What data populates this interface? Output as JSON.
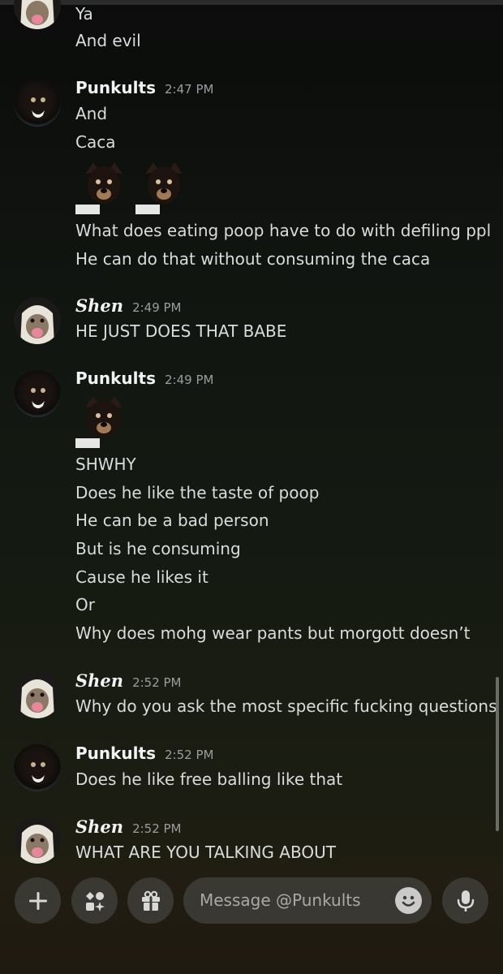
{
  "messages": [
    {
      "type": "continuation",
      "lines": [
        "Ya",
        "And evil"
      ]
    },
    {
      "type": "group",
      "user": "Punkults",
      "avatar": "dog-avatar",
      "time": "2:47 PM",
      "lines": [
        "And",
        "Caca"
      ],
      "stickers": 2,
      "after_lines": [
        "What does eating poop have to do with defiling ppl",
        "He can do that without consuming the caca"
      ]
    },
    {
      "type": "group",
      "user": "Shen",
      "avatar": "mask-avatar",
      "time": "2:49 PM",
      "lines": [
        "HE JUST DOES THAT BABE"
      ]
    },
    {
      "type": "group",
      "user": "Punkults",
      "avatar": "dog-avatar",
      "time": "2:49 PM",
      "stickers": 1,
      "after_lines": [
        "SHWHY",
        "Does he like the taste of poop",
        "He can be a bad person",
        "But is he consuming",
        "Cause he likes it",
        "Or",
        "Why does mohg wear pants but morgott doesn’t"
      ]
    },
    {
      "type": "group",
      "user": "Shen",
      "avatar": "mask-avatar",
      "time": "2:52 PM",
      "lines": [
        "Why do you ask the most specific fucking questions"
      ]
    },
    {
      "type": "group",
      "user": "Punkults",
      "avatar": "dog-avatar",
      "time": "2:52 PM",
      "lines": [
        "Does he like free balling like that"
      ]
    },
    {
      "type": "group",
      "user": "Shen",
      "avatar": "mask-avatar",
      "time": "2:52 PM",
      "lines": [
        "WHAT ARE YOU TALKING ABOUT"
      ]
    }
  ],
  "composer": {
    "placeholder": "Message @Punkults"
  },
  "icons": {
    "add": "plus-icon",
    "apps": "apps-icon",
    "gift": "gift-icon",
    "emoji": "emoji-icon",
    "mic": "microphone-icon"
  },
  "colors": {
    "username": "#f2f3f5",
    "text": "#dadbdd",
    "timestamp": "#9a9ca0",
    "composer": "#3a3833"
  }
}
